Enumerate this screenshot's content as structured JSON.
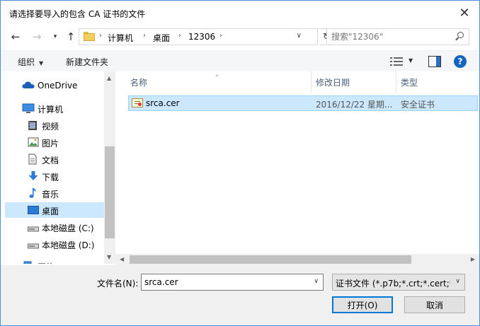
{
  "window": {
    "title": "请选择要导入的包含 CA 证书的文件",
    "close_icon": "close-icon"
  },
  "nav": {
    "back_icon": "arrow-left-icon",
    "forward_icon": "arrow-right-icon",
    "recent_icon": "chevron-down-icon",
    "up_icon": "arrow-up-icon"
  },
  "address": {
    "breadcrumb": [
      "计算机",
      "桌面",
      "12306"
    ],
    "refresh_icon": "refresh-icon"
  },
  "search": {
    "placeholder": "搜索\"12306\""
  },
  "toolbar": {
    "organize_label": "组织",
    "new_folder_label": "新建文件夹"
  },
  "sidebar": {
    "items": [
      {
        "label": "OneDrive",
        "icon": "cloud-icon"
      },
      {
        "label": "计算机",
        "icon": "computer-icon"
      },
      {
        "label": "视频",
        "icon": "video-icon"
      },
      {
        "label": "图片",
        "icon": "picture-icon"
      },
      {
        "label": "文档",
        "icon": "document-icon"
      },
      {
        "label": "下载",
        "icon": "download-icon"
      },
      {
        "label": "音乐",
        "icon": "music-icon"
      },
      {
        "label": "桌面",
        "icon": "desktop-icon",
        "selected": true
      },
      {
        "label": "本地磁盘 (C:)",
        "icon": "drive-icon"
      },
      {
        "label": "本地磁盘 (D:)",
        "icon": "drive-icon"
      },
      {
        "label": "网络",
        "icon": "network-icon"
      }
    ]
  },
  "content": {
    "columns": [
      "名称",
      "修改日期",
      "类型"
    ],
    "files": [
      {
        "name": "srca.cer",
        "date": "2016/12/22 星期...",
        "type": "安全证书",
        "icon": "certificate-icon"
      }
    ]
  },
  "footer": {
    "filename_label": "文件名(N):",
    "filename_value": "srca.cer",
    "filetype_value": "证书文件 (*.p7b;*.crt;*.cert;*.c",
    "open_label": "打开(O)",
    "cancel_label": "取消"
  },
  "colors": {
    "selection": "#cce8ff",
    "selection_border": "#99d1ff",
    "accent": "#0078d7",
    "header_text": "#4c607a"
  }
}
